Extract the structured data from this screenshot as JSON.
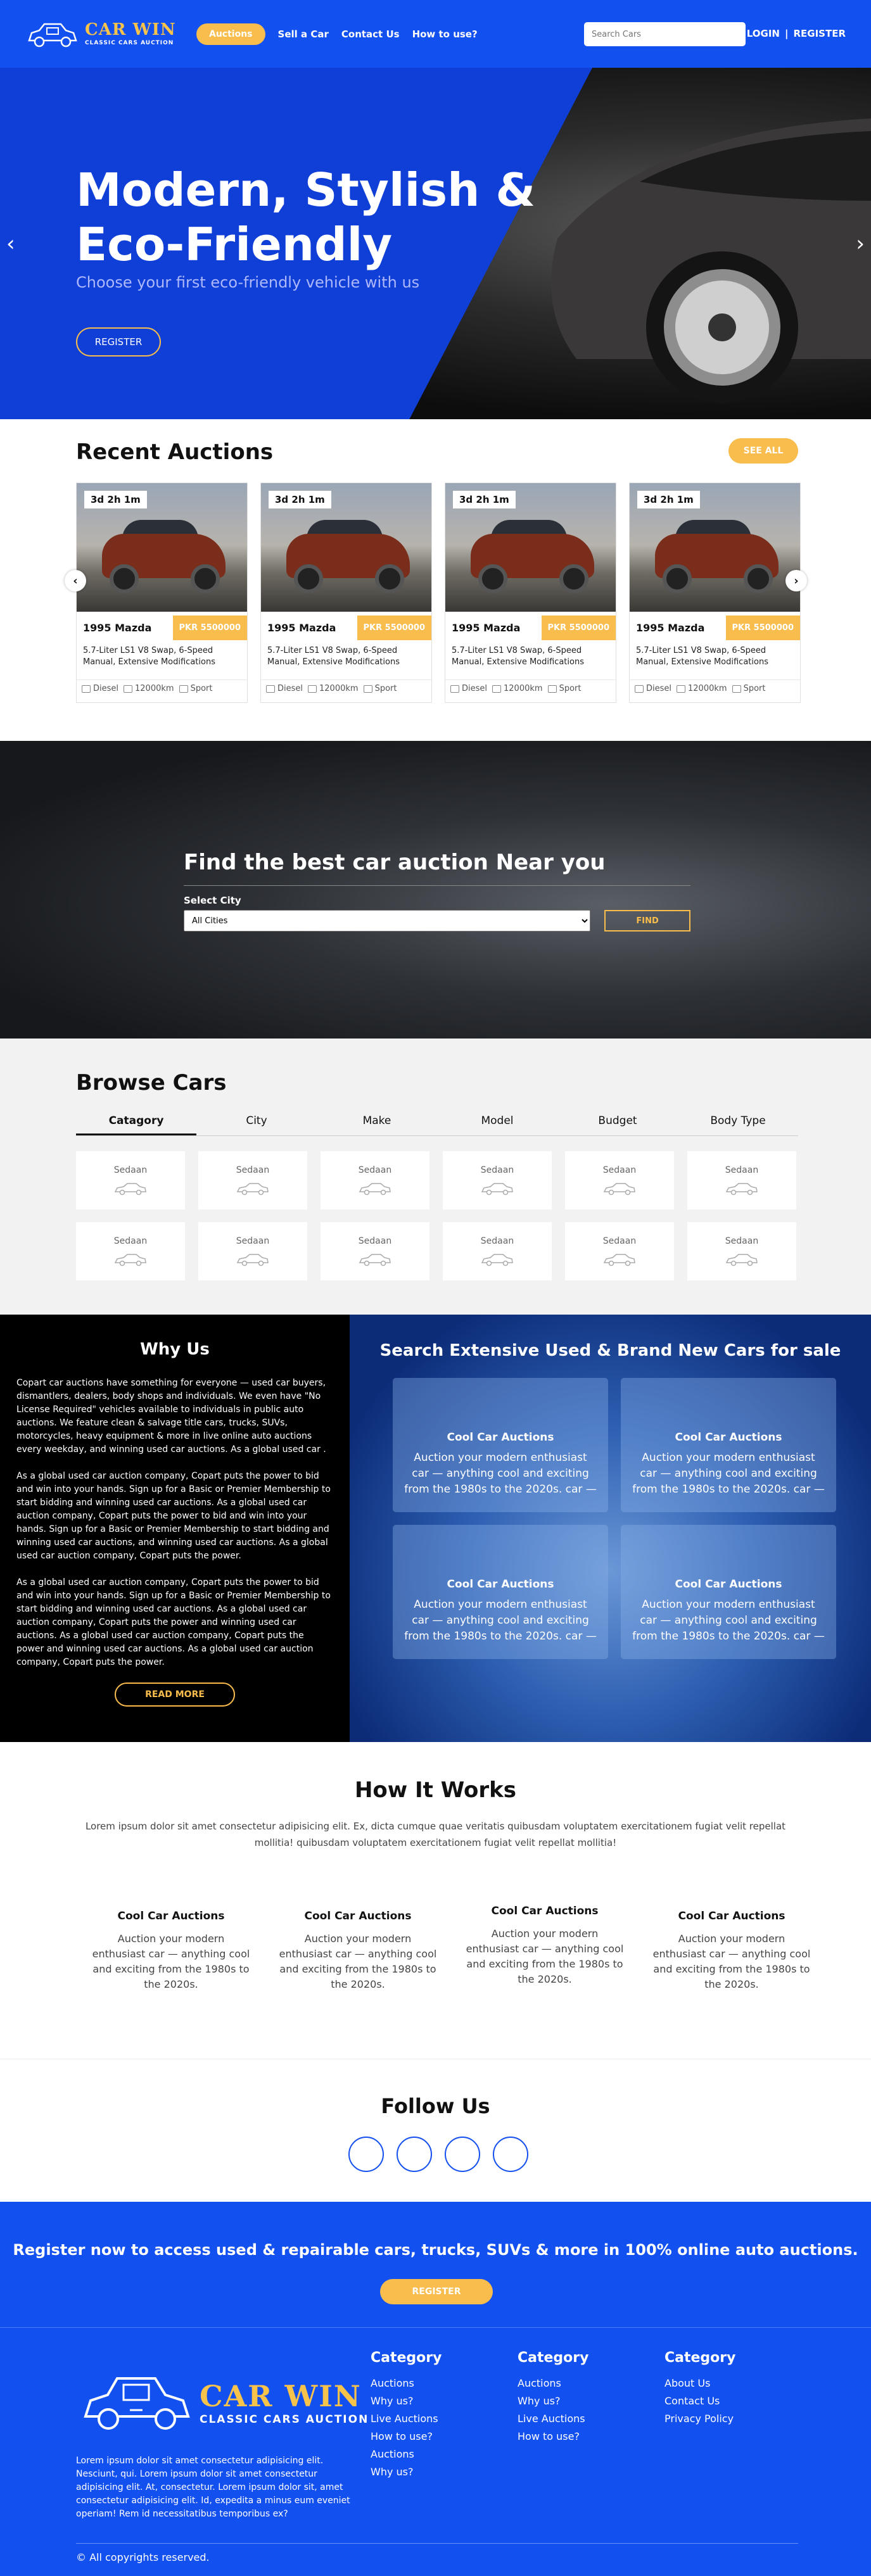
{
  "nav": {
    "brand_title": "CAR WIN",
    "brand_sub": "CLASSIC CARS AUCTION",
    "active": "Auctions",
    "items": [
      "Sell a Car",
      "Contact Us",
      "How to use?"
    ],
    "search_placeholder": "Search Cars",
    "login": "LOGIN",
    "sep": "|",
    "register": "REGISTER"
  },
  "hero": {
    "title": "Modern, Stylish & Eco-Friendly",
    "subtitle": "Choose your first eco-friendly vehicle with us",
    "button": "REGISTER",
    "prev": "‹",
    "next": "›"
  },
  "recent": {
    "title": "Recent Auctions",
    "see_all": "SEE ALL",
    "cards": [
      {
        "timer": "3d 2h 1m",
        "name": "1995 Mazda",
        "price": "PKR 5500000",
        "desc": "5.7-Liter LS1 V8 Swap, 6-Speed Manual, Extensive Modifications",
        "fuel": "Diesel",
        "km": "12000km",
        "type": "Sport"
      },
      {
        "timer": "3d 2h 1m",
        "name": "1995 Mazda",
        "price": "PKR 5500000",
        "desc": "5.7-Liter LS1 V8 Swap, 6-Speed Manual, Extensive Modifications",
        "fuel": "Diesel",
        "km": "12000km",
        "type": "Sport"
      },
      {
        "timer": "3d 2h 1m",
        "name": "1995 Mazda",
        "price": "PKR 5500000",
        "desc": "5.7-Liter LS1 V8 Swap, 6-Speed Manual, Extensive Modifications",
        "fuel": "Diesel",
        "km": "12000km",
        "type": "Sport"
      },
      {
        "timer": "3d 2h 1m",
        "name": "1995 Mazda",
        "price": "PKR 5500000",
        "desc": "5.7-Liter LS1 V8 Swap, 6-Speed Manual, Extensive Modifications",
        "fuel": "Diesel",
        "km": "12000km",
        "type": "Sport"
      }
    ]
  },
  "find": {
    "title": "Find the best car auction Near you",
    "label": "Select City",
    "selected": "All Cities",
    "button": "FIND"
  },
  "browse": {
    "title": "Browse Cars",
    "tabs": [
      "Catagory",
      "City",
      "Make",
      "Model",
      "Budget",
      "Body Type"
    ],
    "tile_label": "Sedaan"
  },
  "why": {
    "title": "Why Us",
    "p1": "Copart car auctions have something for everyone — used car buyers, dismantlers, dealers, body shops and individuals. We even have \"No License Required\" vehicles available to individuals in public auto auctions. We feature clean & salvage title cars, trucks, SUVs, motorcycles, heavy equipment & more in live online auto auctions every weekday, and winning used car auctions. As a global used car .",
    "p2": "As a global used car auction company, Copart puts the power to bid and win into your hands. Sign up for a Basic or Premier Membership to start bidding and winning used car auctions. As a global used car auction company, Copart puts the power to bid and win into your hands. Sign up for a Basic or Premier Membership to start bidding and winning used car auctions, and winning used car auctions. As a global used car auction company, Copart puts the power.",
    "p3": "As a global used car auction company, Copart puts the power to bid and win into your hands. Sign up for a Basic or Premier Membership to start bidding and winning used car auctions. As a global used car auction company, Copart puts the power and winning used car auctions. As a global used car auction company, Copart puts the power and winning used car auctions. As a global used car auction company, Copart puts the power.",
    "button": "READ MORE"
  },
  "search_block": {
    "title": "Search Extensive Used & Brand New Cars for sale",
    "box_title": "Cool Car Auctions",
    "box_text": "Auction your modern enthusiast car — anything cool and exciting from the 1980s to the 2020s. car —"
  },
  "how": {
    "title": "How It Works",
    "intro": "Lorem ipsum dolor sit amet consectetur adipisicing elit. Ex, dicta cumque quae veritatis quibusdam voluptatem exercitationem fugiat velit repellat mollitia! quibusdam voluptatem exercitationem fugiat velit repellat mollitia!",
    "step_title": "Cool Car Auctions",
    "step_text": "Auction your modern enthusiast car — anything cool and exciting from the 1980s to the 2020s."
  },
  "follow": {
    "title": "Follow Us"
  },
  "cta": {
    "text": "Register now to access used & repairable cars, trucks, SUVs & more in 100% online auto auctions.",
    "button": "REGISTER"
  },
  "footer": {
    "brand_title": "CAR WIN",
    "brand_sub": "CLASSIC CARS AUCTION",
    "text": "Lorem ipsum dolor sit amet consectetur adipisicing elit. Nesciunt, qui. Lorem ipsum dolor sit amet consectetur adipisicing elit. At, consectetur. Lorem ipsum dolor sit, amet consectetur adipisicing elit. Id, expedita a minus eum eveniet operiam! Rem id necessitatibus temporibus ex?",
    "col1": {
      "title": "Category",
      "links": [
        "Auctions",
        "Why us?",
        "Live Auctions",
        "How to use?",
        "Auctions",
        "Why us?"
      ]
    },
    "col2": {
      "title": "Category",
      "links": [
        "Auctions",
        "Why us?",
        "Live Auctions",
        "How to use?"
      ]
    },
    "col3": {
      "title": "Category",
      "links": [
        "About Us",
        "Contact Us",
        "Privacy Policy"
      ]
    },
    "copyright": "© All copyrights reserved."
  }
}
